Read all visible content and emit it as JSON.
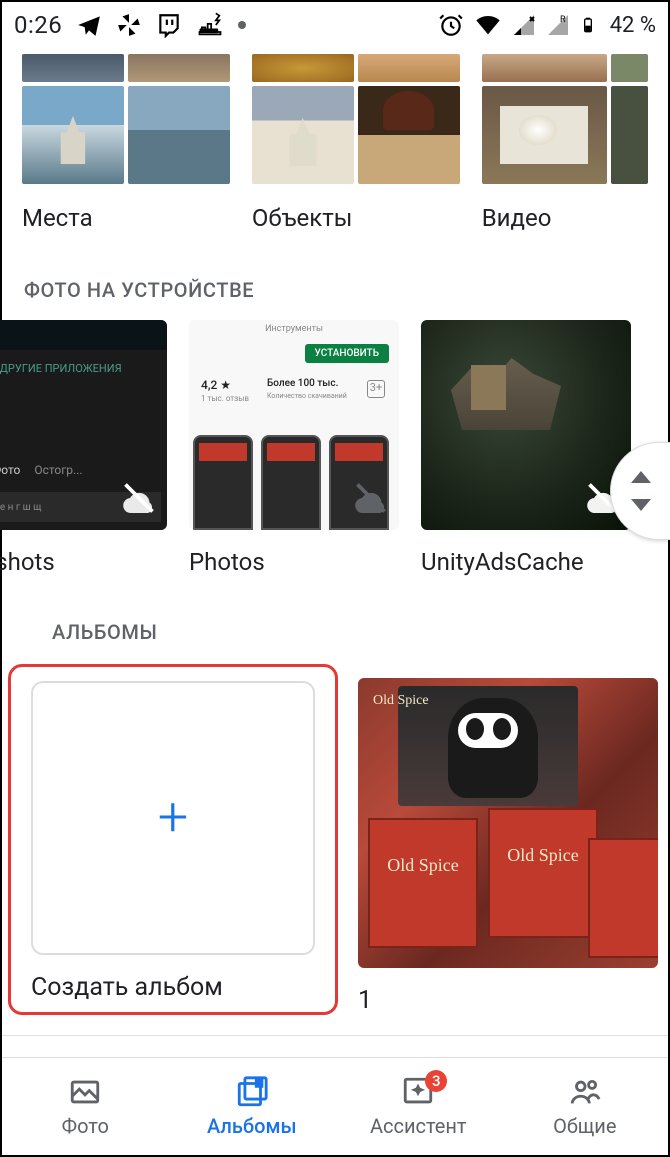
{
  "status": {
    "time": "0:26",
    "battery_text": "42 %"
  },
  "top": {
    "places": "Места",
    "things": "Объекты",
    "videos": "Видео"
  },
  "sections": {
    "device": "ФОТО НА УСТРОЙСТВЕ",
    "albums": "АЛЬБОМЫ"
  },
  "device": {
    "item1": "nshots",
    "item2": "Photos",
    "item3": "UnityAdsCache"
  },
  "albums": {
    "create": "Создать альбом",
    "plus": "+",
    "album1_count": "1"
  },
  "nav": {
    "photos": "Фото",
    "albums": "Альбомы",
    "assistant": "Ассистент",
    "sharing": "Общие",
    "badge": "3"
  },
  "playstore": {
    "install": "УСТАНОВИТЬ",
    "rating": "4,2 ★",
    "reviews": "1 тыс. отзыв",
    "downloads": "Более 100 тыс.",
    "downloads_sub": "Количество скачиваний"
  }
}
